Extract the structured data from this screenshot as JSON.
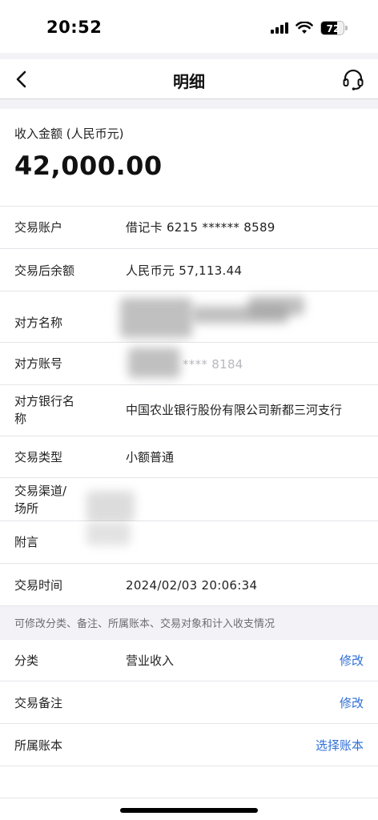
{
  "status_bar": {
    "time": "20:52",
    "battery": "72",
    "battery_level": 0.72
  },
  "nav": {
    "title": "明细",
    "back_icon": "chevron-left-icon",
    "service_icon": "headset-icon"
  },
  "amount": {
    "label": "收入金额 (人民币元)",
    "value": "42,000.00"
  },
  "details": {
    "account_label": "交易账户",
    "account_value": "借记卡 6215 ****** 8589",
    "balance_label": "交易后余额",
    "balance_value": "人民币元 57,113.44",
    "counterparty_name_label": "对方名称",
    "counterparty_account_label": "对方账号",
    "counterparty_account_value": "**** 8184",
    "counterparty_bank_label": "对方银行名称",
    "counterparty_bank_value": "中国农业银行股份有限公司新都三河支行",
    "type_label": "交易类型",
    "type_value": "小额普通",
    "channel_label": "交易渠道/场所",
    "remark_label": "附言",
    "time_label": "交易时间",
    "time_value": "2024/02/03 20:06:34"
  },
  "notice": "可修改分类、备注、所属账本、交易对象和计入收支情况",
  "editable": {
    "category_label": "分类",
    "category_value": "营业收入",
    "category_action": "修改",
    "note_label": "交易备注",
    "note_action": "修改",
    "book_label": "所属账本",
    "book_action": "选择账本"
  },
  "colors": {
    "accent": "#2f6fd6",
    "background": "#f2f2f7"
  }
}
